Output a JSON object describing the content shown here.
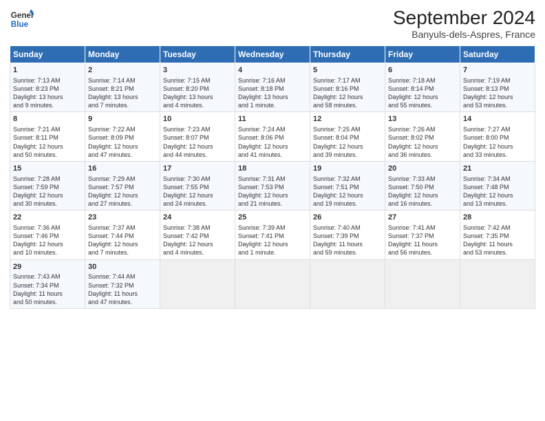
{
  "header": {
    "logo_line1": "General",
    "logo_line2": "Blue",
    "main_title": "September 2024",
    "subtitle": "Banyuls-dels-Aspres, France"
  },
  "days_of_week": [
    "Sunday",
    "Monday",
    "Tuesday",
    "Wednesday",
    "Thursday",
    "Friday",
    "Saturday"
  ],
  "weeks": [
    [
      {
        "day": "1",
        "lines": [
          "Sunrise: 7:13 AM",
          "Sunset: 8:23 PM",
          "Daylight: 13 hours",
          "and 9 minutes."
        ]
      },
      {
        "day": "2",
        "lines": [
          "Sunrise: 7:14 AM",
          "Sunset: 8:21 PM",
          "Daylight: 13 hours",
          "and 7 minutes."
        ]
      },
      {
        "day": "3",
        "lines": [
          "Sunrise: 7:15 AM",
          "Sunset: 8:20 PM",
          "Daylight: 13 hours",
          "and 4 minutes."
        ]
      },
      {
        "day": "4",
        "lines": [
          "Sunrise: 7:16 AM",
          "Sunset: 8:18 PM",
          "Daylight: 13 hours",
          "and 1 minute."
        ]
      },
      {
        "day": "5",
        "lines": [
          "Sunrise: 7:17 AM",
          "Sunset: 8:16 PM",
          "Daylight: 12 hours",
          "and 58 minutes."
        ]
      },
      {
        "day": "6",
        "lines": [
          "Sunrise: 7:18 AM",
          "Sunset: 8:14 PM",
          "Daylight: 12 hours",
          "and 55 minutes."
        ]
      },
      {
        "day": "7",
        "lines": [
          "Sunrise: 7:19 AM",
          "Sunset: 8:13 PM",
          "Daylight: 12 hours",
          "and 53 minutes."
        ]
      }
    ],
    [
      {
        "day": "8",
        "lines": [
          "Sunrise: 7:21 AM",
          "Sunset: 8:11 PM",
          "Daylight: 12 hours",
          "and 50 minutes."
        ]
      },
      {
        "day": "9",
        "lines": [
          "Sunrise: 7:22 AM",
          "Sunset: 8:09 PM",
          "Daylight: 12 hours",
          "and 47 minutes."
        ]
      },
      {
        "day": "10",
        "lines": [
          "Sunrise: 7:23 AM",
          "Sunset: 8:07 PM",
          "Daylight: 12 hours",
          "and 44 minutes."
        ]
      },
      {
        "day": "11",
        "lines": [
          "Sunrise: 7:24 AM",
          "Sunset: 8:06 PM",
          "Daylight: 12 hours",
          "and 41 minutes."
        ]
      },
      {
        "day": "12",
        "lines": [
          "Sunrise: 7:25 AM",
          "Sunset: 8:04 PM",
          "Daylight: 12 hours",
          "and 39 minutes."
        ]
      },
      {
        "day": "13",
        "lines": [
          "Sunrise: 7:26 AM",
          "Sunset: 8:02 PM",
          "Daylight: 12 hours",
          "and 36 minutes."
        ]
      },
      {
        "day": "14",
        "lines": [
          "Sunrise: 7:27 AM",
          "Sunset: 8:00 PM",
          "Daylight: 12 hours",
          "and 33 minutes."
        ]
      }
    ],
    [
      {
        "day": "15",
        "lines": [
          "Sunrise: 7:28 AM",
          "Sunset: 7:59 PM",
          "Daylight: 12 hours",
          "and 30 minutes."
        ]
      },
      {
        "day": "16",
        "lines": [
          "Sunrise: 7:29 AM",
          "Sunset: 7:57 PM",
          "Daylight: 12 hours",
          "and 27 minutes."
        ]
      },
      {
        "day": "17",
        "lines": [
          "Sunrise: 7:30 AM",
          "Sunset: 7:55 PM",
          "Daylight: 12 hours",
          "and 24 minutes."
        ]
      },
      {
        "day": "18",
        "lines": [
          "Sunrise: 7:31 AM",
          "Sunset: 7:53 PM",
          "Daylight: 12 hours",
          "and 21 minutes."
        ]
      },
      {
        "day": "19",
        "lines": [
          "Sunrise: 7:32 AM",
          "Sunset: 7:51 PM",
          "Daylight: 12 hours",
          "and 19 minutes."
        ]
      },
      {
        "day": "20",
        "lines": [
          "Sunrise: 7:33 AM",
          "Sunset: 7:50 PM",
          "Daylight: 12 hours",
          "and 16 minutes."
        ]
      },
      {
        "day": "21",
        "lines": [
          "Sunrise: 7:34 AM",
          "Sunset: 7:48 PM",
          "Daylight: 12 hours",
          "and 13 minutes."
        ]
      }
    ],
    [
      {
        "day": "22",
        "lines": [
          "Sunrise: 7:36 AM",
          "Sunset: 7:46 PM",
          "Daylight: 12 hours",
          "and 10 minutes."
        ]
      },
      {
        "day": "23",
        "lines": [
          "Sunrise: 7:37 AM",
          "Sunset: 7:44 PM",
          "Daylight: 12 hours",
          "and 7 minutes."
        ]
      },
      {
        "day": "24",
        "lines": [
          "Sunrise: 7:38 AM",
          "Sunset: 7:42 PM",
          "Daylight: 12 hours",
          "and 4 minutes."
        ]
      },
      {
        "day": "25",
        "lines": [
          "Sunrise: 7:39 AM",
          "Sunset: 7:41 PM",
          "Daylight: 12 hours",
          "and 1 minute."
        ]
      },
      {
        "day": "26",
        "lines": [
          "Sunrise: 7:40 AM",
          "Sunset: 7:39 PM",
          "Daylight: 11 hours",
          "and 59 minutes."
        ]
      },
      {
        "day": "27",
        "lines": [
          "Sunrise: 7:41 AM",
          "Sunset: 7:37 PM",
          "Daylight: 11 hours",
          "and 56 minutes."
        ]
      },
      {
        "day": "28",
        "lines": [
          "Sunrise: 7:42 AM",
          "Sunset: 7:35 PM",
          "Daylight: 11 hours",
          "and 53 minutes."
        ]
      }
    ],
    [
      {
        "day": "29",
        "lines": [
          "Sunrise: 7:43 AM",
          "Sunset: 7:34 PM",
          "Daylight: 11 hours",
          "and 50 minutes."
        ]
      },
      {
        "day": "30",
        "lines": [
          "Sunrise: 7:44 AM",
          "Sunset: 7:32 PM",
          "Daylight: 11 hours",
          "and 47 minutes."
        ]
      },
      null,
      null,
      null,
      null,
      null
    ]
  ]
}
